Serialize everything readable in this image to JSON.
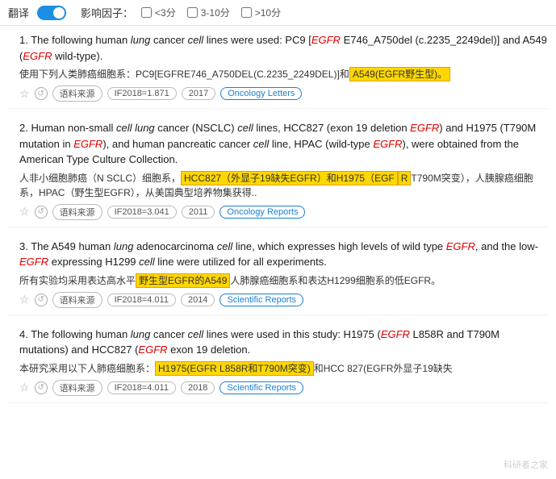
{
  "toolbar": {
    "translate_label": "翻译",
    "impact_label": "影响因子：",
    "toggle_state": "on",
    "checkboxes": [
      {
        "label": "<3分",
        "checked": false
      },
      {
        "label": "3-10分",
        "checked": false
      },
      {
        "label": ">10分",
        "checked": false
      }
    ]
  },
  "results": [
    {
      "number": "1.",
      "en_text_parts": [
        {
          "type": "normal",
          "text": "The following human "
        },
        {
          "type": "italic",
          "text": "lung"
        },
        {
          "type": "normal",
          "text": " cancer "
        },
        {
          "type": "italic",
          "text": "cell"
        },
        {
          "type": "normal",
          "text": " lines were used: PC9 ["
        },
        {
          "type": "gene",
          "text": "EGFR"
        },
        {
          "type": "normal",
          "text": " E746_A750del (c.2235_2249del)] and A549 ("
        },
        {
          "type": "gene",
          "text": "EGFR"
        },
        {
          "type": "normal",
          "text": " wild-type)."
        }
      ],
      "cn_text": "使用下列人类肺癌细胞系：PC9[EGFRE746_A750DEL(C.2235_2249DEL)]和",
      "cn_highlight": "A549(EGFR野生型)。",
      "cn_after": "",
      "if_value": "IF2018=1.871",
      "year": "2017",
      "journal": "Oncology Letters",
      "source_label": "语料来源"
    },
    {
      "number": "2.",
      "en_text_parts": [
        {
          "type": "normal",
          "text": "Human non-small "
        },
        {
          "type": "italic",
          "text": "cell lung"
        },
        {
          "type": "normal",
          "text": " cancer (NSCLC) "
        },
        {
          "type": "italic",
          "text": "cell"
        },
        {
          "type": "normal",
          "text": " lines, HCC827 (exon 19 deletion "
        },
        {
          "type": "gene",
          "text": "EGF"
        },
        {
          "type": "gene-break",
          "text": "R"
        },
        {
          "type": "normal",
          "text": ") and H1975 (T790M mutation in "
        },
        {
          "type": "gene",
          "text": "EGFR"
        },
        {
          "type": "normal",
          "text": "), and human pancreatic cancer "
        },
        {
          "type": "italic",
          "text": "cell"
        },
        {
          "type": "normal",
          "text": " line, HPAC (wild-type "
        },
        {
          "type": "gene",
          "text": "EGFR"
        },
        {
          "type": "normal",
          "text": "), were obtained from the American Type Culture Collection."
        }
      ],
      "cn_before": "人非小细胞肺癌（N SCLC）细胞系，",
      "cn_highlight1": "HCC827（外显子19缺失EGFR）和H1975（EGF",
      "cn_highlight2": "R",
      "cn_after2": "T790M突变），人胰腺癌细胞系，HPAC（野生型EGFR），从美国典型培养物集获得..",
      "if_value": "IF2018=3.041",
      "year": "2011",
      "journal": "Oncology Reports",
      "source_label": "语料来源"
    },
    {
      "number": "3.",
      "en_text_parts": [
        {
          "type": "normal",
          "text": "The A549 human "
        },
        {
          "type": "italic",
          "text": "lung"
        },
        {
          "type": "normal",
          "text": " adenocarcinoma "
        },
        {
          "type": "italic",
          "text": "cell"
        },
        {
          "type": "normal",
          "text": " line, which expresses high levels of wild type "
        },
        {
          "type": "gene",
          "text": "EGFR"
        },
        {
          "type": "normal",
          "text": ", and the low-"
        },
        {
          "type": "gene",
          "text": "EGFR"
        },
        {
          "type": "normal",
          "text": " expressing H1299 "
        },
        {
          "type": "italic",
          "text": "cell"
        },
        {
          "type": "normal",
          "text": " line were utilized for all experiments."
        }
      ],
      "cn_before": "所有实验均采用表达高水平",
      "cn_highlight": "野生型EGFR的A549",
      "cn_after": "人肺腺癌细胞系和表达H1299细胞系的低EGFR。",
      "if_value": "IF2018=4.011",
      "year": "2014",
      "journal": "Scientific Reports",
      "source_label": "语料来源"
    },
    {
      "number": "4.",
      "en_text_parts": [
        {
          "type": "normal",
          "text": "The following human "
        },
        {
          "type": "italic",
          "text": "lung"
        },
        {
          "type": "normal",
          "text": " cancer "
        },
        {
          "type": "italic",
          "text": "cell"
        },
        {
          "type": "normal",
          "text": " lines were used in this study: H1975 ("
        },
        {
          "type": "gene",
          "text": "EGFR"
        },
        {
          "type": "normal",
          "text": " L858R and T790M mutations) and HCC827 ("
        },
        {
          "type": "gene",
          "text": "EGFR"
        },
        {
          "type": "normal",
          "text": " exon 19 deletion."
        }
      ],
      "cn_before": "本研究采用以下人肺癌细胞系：",
      "cn_highlight": "H1975(EGFR L858R和T790M突变)",
      "cn_after": "和HCC 827(EGFR外显子19缺失",
      "if_value": "IF2018=4.011",
      "year": "2018",
      "journal": "Scientific Reports",
      "source_label": "语料来源"
    }
  ],
  "watermark": "科研者之家"
}
